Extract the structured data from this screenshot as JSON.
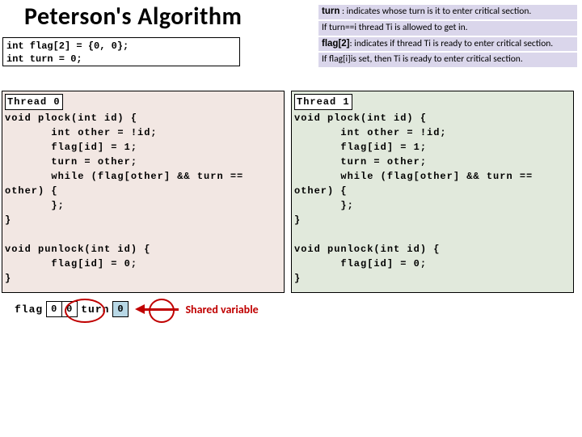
{
  "title": "Peterson's Algorithm",
  "decl": {
    "line1": "int flag[2] = {0, 0};",
    "line2": "int turn = 0;"
  },
  "notes": [
    {
      "term": "turn",
      "text": " : indicates whose turn is it to enter critical section."
    },
    {
      "term": "",
      "text": "If turn==i thread Ti is allowed to get in."
    },
    {
      "term": "flag[2]",
      "text": ": indicates if thread Ti is ready to enter critical section."
    },
    {
      "term": "",
      "text": "If flag[i]is set, then Ti is ready to enter critical section."
    }
  ],
  "thread0": {
    "header": "Thread 0",
    "body": "void plock(int id) {\n       int other = !id;\n       flag[id] = 1;\n       turn = other;\n       while (flag[other] && turn ==\nother) {\n       };\n}\n\nvoid punlock(int id) {\n       flag[id] = 0;\n}"
  },
  "thread1": {
    "header": "Thread 1",
    "body": "void plock(int id) {\n       int other = !id;\n       flag[id] = 1;\n       turn = other;\n       while (flag[other] && turn ==\nother) {\n       };\n}\n\nvoid punlock(int id) {\n       flag[id] = 0;\n}"
  },
  "shared": {
    "flag_label": "flag",
    "flag_vals": [
      "0",
      "0"
    ],
    "turn_label": "turn",
    "turn_val": "0",
    "arrow_label": "Shared variable"
  }
}
